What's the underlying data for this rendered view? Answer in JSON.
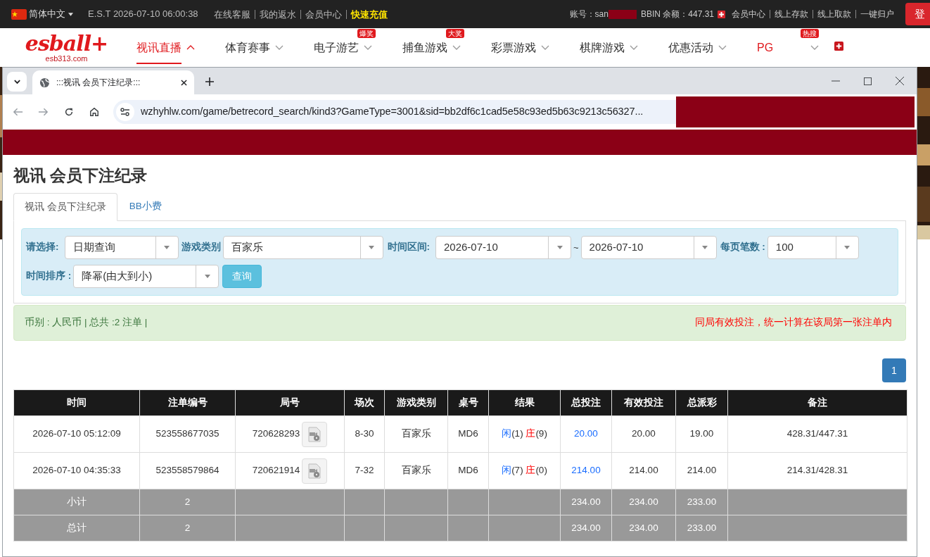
{
  "top_bar": {
    "language": "简体中文",
    "clock": "E.S.T 2026-07-10 06:00:38",
    "links": [
      {
        "label": "在线客服",
        "highlight": false
      },
      {
        "label": "我的返水",
        "highlight": false
      },
      {
        "label": "会员中心",
        "highlight": false
      },
      {
        "label": "快速充值",
        "highlight": true
      }
    ],
    "account_label": "账号：san",
    "balance": "BBIN 余额：447.31",
    "account_links": [
      "会员中心",
      "线上存款",
      "线上取款",
      "一键归户"
    ],
    "login_button": "登"
  },
  "site_nav": {
    "logo": "esball+",
    "logo_domain": "esb313.com",
    "items": [
      {
        "label": "视讯直播",
        "selected": true
      },
      {
        "label": "体育赛事",
        "selected": false
      },
      {
        "label": "电子游艺",
        "selected": false,
        "badge": "爆奖"
      },
      {
        "label": "捕鱼游戏",
        "selected": false,
        "badge": "大奖"
      },
      {
        "label": "彩票游戏",
        "selected": false
      },
      {
        "label": "棋牌游戏",
        "selected": false
      },
      {
        "label": "优惠活动",
        "selected": false
      },
      {
        "label": "PG",
        "selected": false,
        "accent": true,
        "badge": "热搜"
      }
    ]
  },
  "browser": {
    "tab_title": ":::视讯 会员下注纪录:::",
    "url": "wzhyhlw.com/game/betrecord_search/kind3?GameType=3001&sid=bb2df6c1cad5e58c93ed5b63c9213c56327..."
  },
  "page": {
    "title": "视讯 会员下注纪录",
    "tabs": [
      {
        "label": "视讯 会员下注纪录",
        "selected": true
      },
      {
        "label": "BB小费",
        "selected": false
      }
    ],
    "filters": {
      "select_label": "请选择:",
      "select_value": "日期查询",
      "game_label": "游戏类别",
      "game_value": "百家乐",
      "range_label": "时间区间:",
      "date_from": "2026-07-10",
      "range_sep": "~",
      "date_to": "2026-07-10",
      "per_page_label": "每页笔数 :",
      "per_page_value": "100",
      "sort_label": "时间排序 :",
      "sort_value": "降幂(由大到小)",
      "search_button": "查询"
    },
    "summary": "币别 : 人民币 | 总共 :2 注单 |",
    "notice": "同局有效投注，统一计算在该局第一张注单内",
    "pages": [
      {
        "label": "1",
        "selected": true
      }
    ],
    "table": {
      "columns": [
        "时间",
        "注单编号",
        "局号",
        "场次",
        "游戏类别",
        "桌号",
        "结果",
        "总投注",
        "有效投注",
        "总派彩",
        "备注"
      ],
      "rows": [
        {
          "kind": "bet",
          "time": "2026-07-10 05:12:09",
          "bet_no": "523558677035",
          "round": "720628293",
          "game_no": "8-30",
          "game": "百家乐",
          "table": "MD6",
          "result": {
            "player": "闲",
            "player_score": "(1)",
            "banker": "庄",
            "banker_score": "(9)"
          },
          "total_bet": "20.00",
          "valid_bet": "20.00",
          "payout": "19.00",
          "note": "428.31/447.31"
        },
        {
          "kind": "bet",
          "time": "2026-07-10 04:35:33",
          "bet_no": "523558579864",
          "round": "720621914",
          "game_no": "7-32",
          "game": "百家乐",
          "table": "MD6",
          "result": {
            "player": "闲",
            "player_score": "(7)",
            "banker": "庄",
            "banker_score": "(0)"
          },
          "total_bet": "214.00",
          "valid_bet": "214.00",
          "payout": "214.00",
          "note": "214.31/428.31"
        },
        {
          "kind": "summary",
          "time": "小计",
          "bet_no": "2",
          "total_bet": "234.00",
          "valid_bet": "234.00",
          "payout": "233.00"
        },
        {
          "kind": "summary",
          "time": "总计",
          "bet_no": "2",
          "total_bet": "234.00",
          "valid_bet": "234.00",
          "payout": "233.00"
        }
      ]
    }
  }
}
